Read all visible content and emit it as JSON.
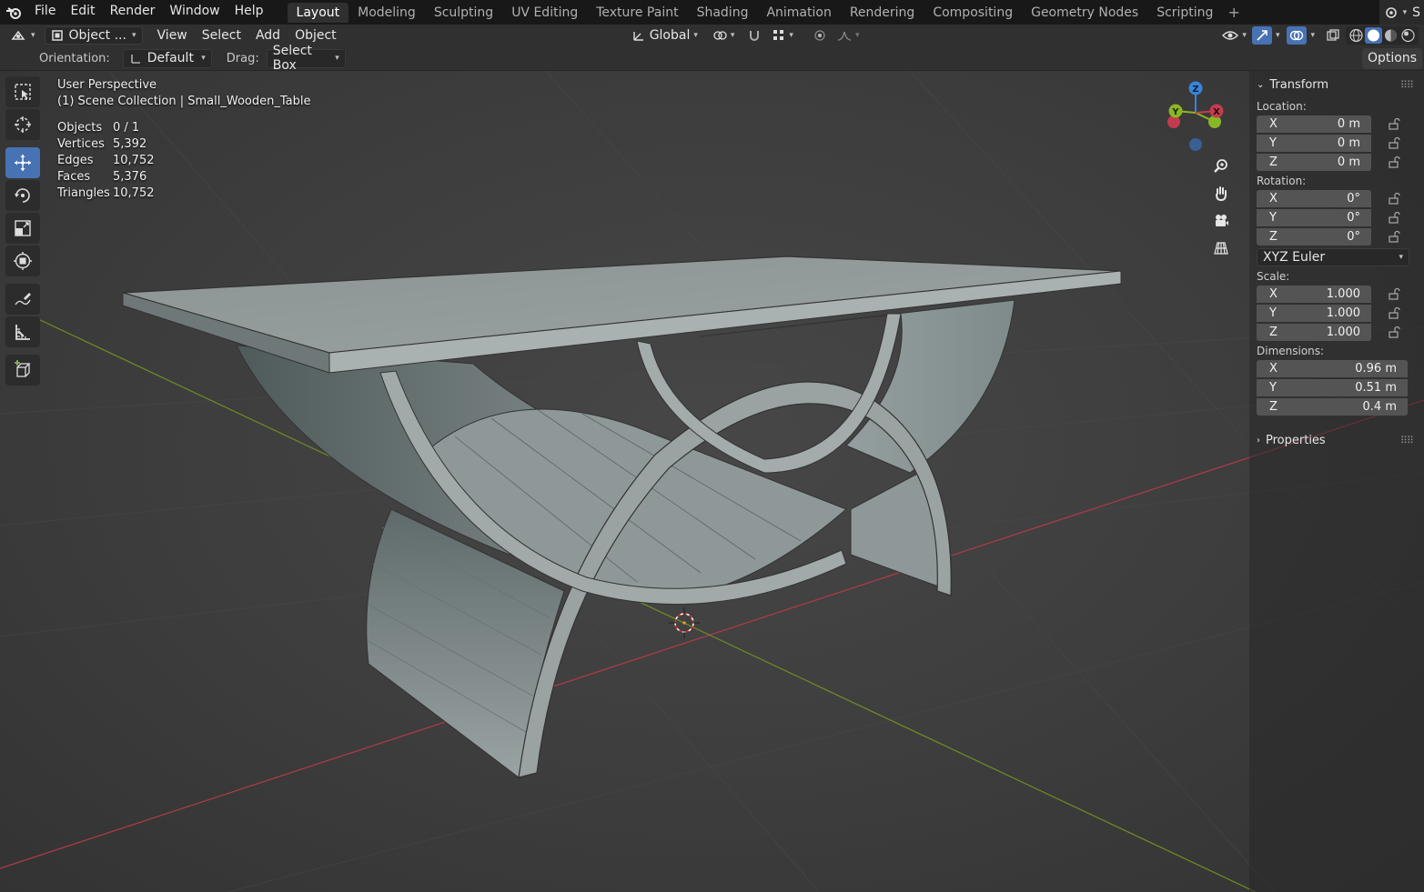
{
  "topbar": {
    "menus": [
      "File",
      "Edit",
      "Render",
      "Window",
      "Help"
    ],
    "workspaces": [
      {
        "label": "Layout",
        "active": true
      },
      {
        "label": "Modeling",
        "active": false
      },
      {
        "label": "Sculpting",
        "active": false
      },
      {
        "label": "UV Editing",
        "active": false
      },
      {
        "label": "Texture Paint",
        "active": false
      },
      {
        "label": "Shading",
        "active": false
      },
      {
        "label": "Animation",
        "active": false
      },
      {
        "label": "Rendering",
        "active": false
      },
      {
        "label": "Compositing",
        "active": false
      },
      {
        "label": "Geometry Nodes",
        "active": false
      },
      {
        "label": "Scripting",
        "active": false
      }
    ],
    "add_workspace": "+",
    "scene_glyph": "S"
  },
  "header": {
    "mode": "Object ...",
    "menus": [
      "View",
      "Select",
      "Add",
      "Object"
    ],
    "transform_orientation": "Global",
    "options_label": "Options"
  },
  "tool_settings": {
    "orientation_label": "Orientation:",
    "orientation_value": "Default",
    "drag_label": "Drag:",
    "drag_value": "Select Box"
  },
  "toolbar": {
    "tools": [
      {
        "name": "select-box-tool",
        "icon": "select-box-icon",
        "active": false
      },
      {
        "name": "cursor-tool",
        "icon": "cursor-icon",
        "active": false
      },
      {
        "name": "move-tool",
        "icon": "move-icon",
        "active": true
      },
      {
        "name": "rotate-tool",
        "icon": "rotate-icon",
        "active": false
      },
      {
        "name": "scale-tool",
        "icon": "scale-icon",
        "active": false
      },
      {
        "name": "transform-tool",
        "icon": "transform-icon",
        "active": false
      },
      {
        "name": "annotate-tool",
        "icon": "annotate-icon",
        "active": false
      },
      {
        "name": "measure-tool",
        "icon": "measure-icon",
        "active": false
      },
      {
        "name": "add-cube-tool",
        "icon": "add-cube-icon",
        "active": false
      }
    ]
  },
  "viewport": {
    "view_name": "User Perspective",
    "collection": "(1) Scene Collection | Small_Wooden_Table",
    "stats": [
      {
        "label": "Objects",
        "value": "0 / 1"
      },
      {
        "label": "Vertices",
        "value": "5,392"
      },
      {
        "label": "Edges",
        "value": "10,752"
      },
      {
        "label": "Faces",
        "value": "5,376"
      },
      {
        "label": "Triangles",
        "value": "10,752"
      }
    ],
    "gizmo": {
      "x": "X",
      "y": "Y",
      "z": "Z"
    }
  },
  "npanel": {
    "transform_title": "Transform",
    "location_label": "Location:",
    "location": [
      {
        "axis": "X",
        "value": "0 m"
      },
      {
        "axis": "Y",
        "value": "0 m"
      },
      {
        "axis": "Z",
        "value": "0 m"
      }
    ],
    "rotation_label": "Rotation:",
    "rotation": [
      {
        "axis": "X",
        "value": "0°"
      },
      {
        "axis": "Y",
        "value": "0°"
      },
      {
        "axis": "Z",
        "value": "0°"
      }
    ],
    "rotation_mode": "XYZ Euler",
    "scale_label": "Scale:",
    "scale": [
      {
        "axis": "X",
        "value": "1.000"
      },
      {
        "axis": "Y",
        "value": "1.000"
      },
      {
        "axis": "Z",
        "value": "1.000"
      }
    ],
    "dimensions_label": "Dimensions:",
    "dimensions": [
      {
        "axis": "X",
        "value": "0.96 m"
      },
      {
        "axis": "Y",
        "value": "0.51 m"
      },
      {
        "axis": "Z",
        "value": "0.4 m"
      }
    ],
    "properties_title": "Properties"
  },
  "colors": {
    "accent": "#4772b3",
    "x_axis": "#c33c4d",
    "y_axis": "#8ab626",
    "z_axis": "#3a84d9"
  }
}
